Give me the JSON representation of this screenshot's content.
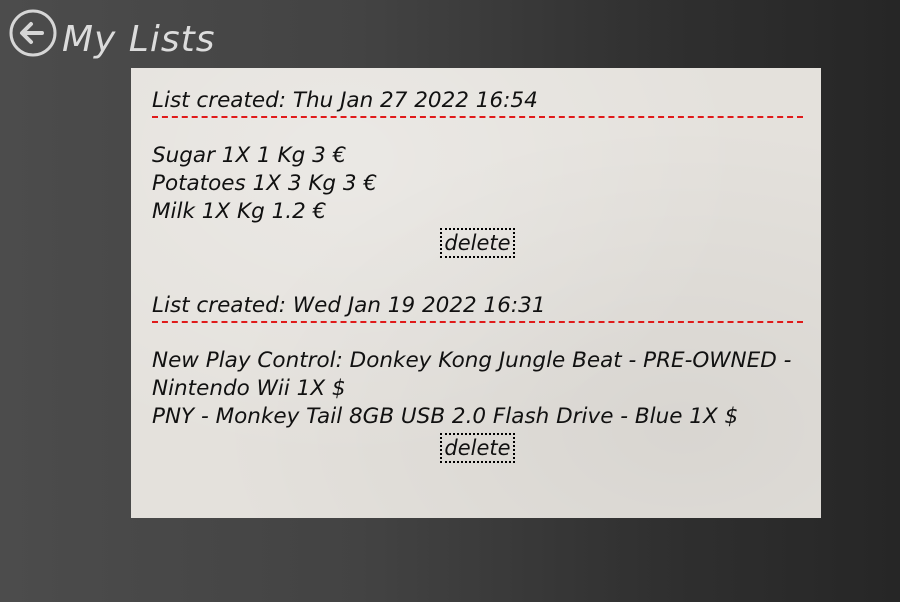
{
  "header": {
    "title": "My Lists",
    "back_icon": "arrow-left-circle-icon"
  },
  "lists": [
    {
      "created": "List created: Thu Jan 27 2022 16:54",
      "items": [
        "Sugar 1X 1 Kg 3 €",
        "Potatoes 1X 3 Kg 3 €",
        "Milk 1X Kg 1.2 €"
      ],
      "delete_label": "delete"
    },
    {
      "created": "List created: Wed Jan 19 2022 16:31",
      "items": [
        "New Play Control: Donkey Kong Jungle Beat - PRE-OWNED - Nintendo Wii 1X $",
        "PNY - Monkey Tail 8GB USB 2.0 Flash Drive - Blue 1X $"
      ],
      "delete_label": "delete"
    }
  ],
  "colors": {
    "divider": "#e01a1a",
    "title": "#dcdcdc",
    "paper": "#e4e1dc"
  }
}
